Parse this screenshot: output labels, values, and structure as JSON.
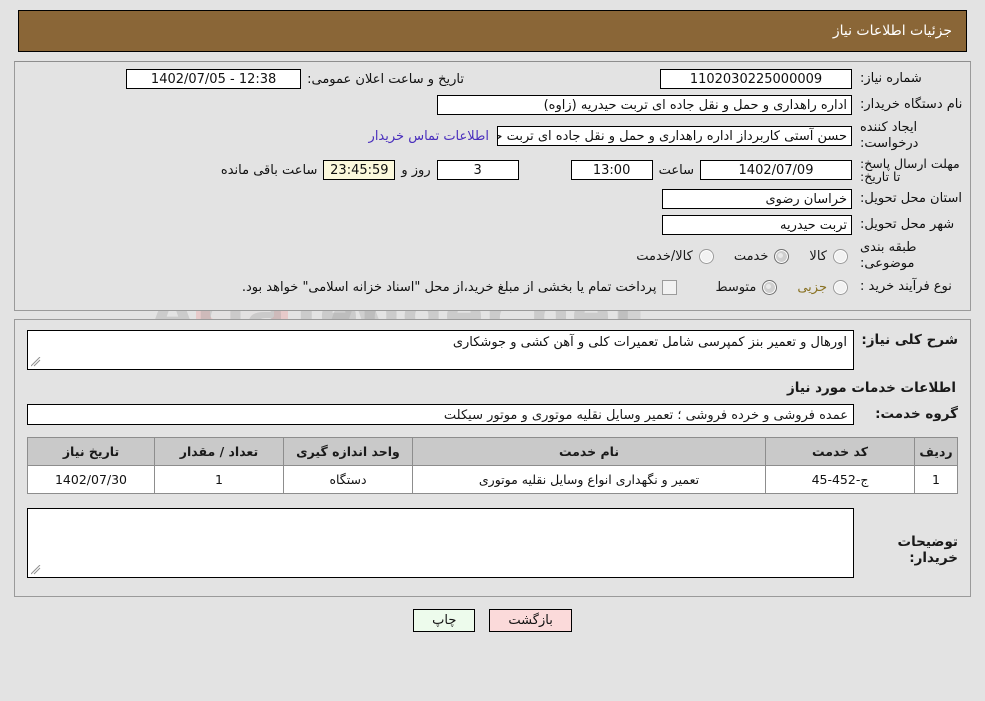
{
  "header": {
    "title": "جزئیات اطلاعات نیاز"
  },
  "watermark": {
    "text": "AriaTender.net"
  },
  "form": {
    "need_number": {
      "label": "شماره نیاز:",
      "value": "1102030225000009"
    },
    "public_announce": {
      "label": "تاریخ و ساعت اعلان عمومی:",
      "value": "12:38 - 1402/07/05"
    },
    "buyer_org": {
      "label": "نام دستگاه خریدار:",
      "value": "اداره راهداری و حمل و نقل جاده ای تربت حیدریه (زاوه)"
    },
    "request_creator": {
      "label": "ایجاد کننده درخواست:",
      "value": "حسن آستی کاربرداز اداره راهداری و حمل و نقل جاده ای تربت حیدریه (زاوه)"
    },
    "contact_link": "اطلاعات تماس خریدار",
    "deadline": {
      "label": "مهلت ارسال پاسخ: تا تاریخ:",
      "date": "1402/07/09",
      "hour_label": "ساعت",
      "hour": "13:00",
      "days": "3",
      "days_label": "روز و",
      "countdown": "23:45:59",
      "countdown_label": "ساعت باقی مانده"
    },
    "province": {
      "label": "استان محل تحویل:",
      "value": "خراسان رضوی"
    },
    "city": {
      "label": "شهر محل تحویل:",
      "value": "تربت حیدریه"
    },
    "category": {
      "label": "طبقه بندی موضوعی:",
      "options": [
        {
          "label": "کالا",
          "checked": false
        },
        {
          "label": "خدمت",
          "checked": true
        },
        {
          "label": "کالا/خدمت",
          "checked": false
        }
      ]
    },
    "purchase_type": {
      "label": "نوع فرآیند خرید :",
      "options": [
        {
          "label": "جزیی",
          "checked": false
        },
        {
          "label": "متوسط",
          "checked": true
        }
      ],
      "treasury_checkbox_checked": false,
      "treasury_note": "پرداخت تمام یا بخشی از مبلغ خرید،از محل \"اسناد خزانه اسلامی\" خواهد بود."
    }
  },
  "description": {
    "need_summary_label": "شرح کلی نیاز:",
    "need_summary_value": "اورهال و تعمیر بنز کمپرسی شامل تعمیرات کلی و آهن کشی و جوشکاری",
    "services_title": "اطلاعات خدمات مورد نیاز",
    "service_group_label": "گروه خدمت:",
    "service_group_value": "عمده فروشی و خرده فروشی ؛ تعمیر وسایل نقلیه موتوری و موتور سیکلت"
  },
  "table": {
    "headers": [
      "ردیف",
      "کد خدمت",
      "نام خدمت",
      "واحد اندازه گیری",
      "تعداد / مقدار",
      "تاریخ نیاز"
    ],
    "rows": [
      {
        "radif": "1",
        "code": "ج-452-45",
        "name": "تعمیر و نگهداری انواع وسایل نقلیه موتوری",
        "unit": "دستگاه",
        "qty": "1",
        "date": "1402/07/30"
      }
    ]
  },
  "buyer_notes": {
    "label": "توضیحات خریدار:",
    "value": "",
    "placeholder": ""
  },
  "buttons": {
    "print": "چاپ",
    "back": "بازگشت"
  }
}
